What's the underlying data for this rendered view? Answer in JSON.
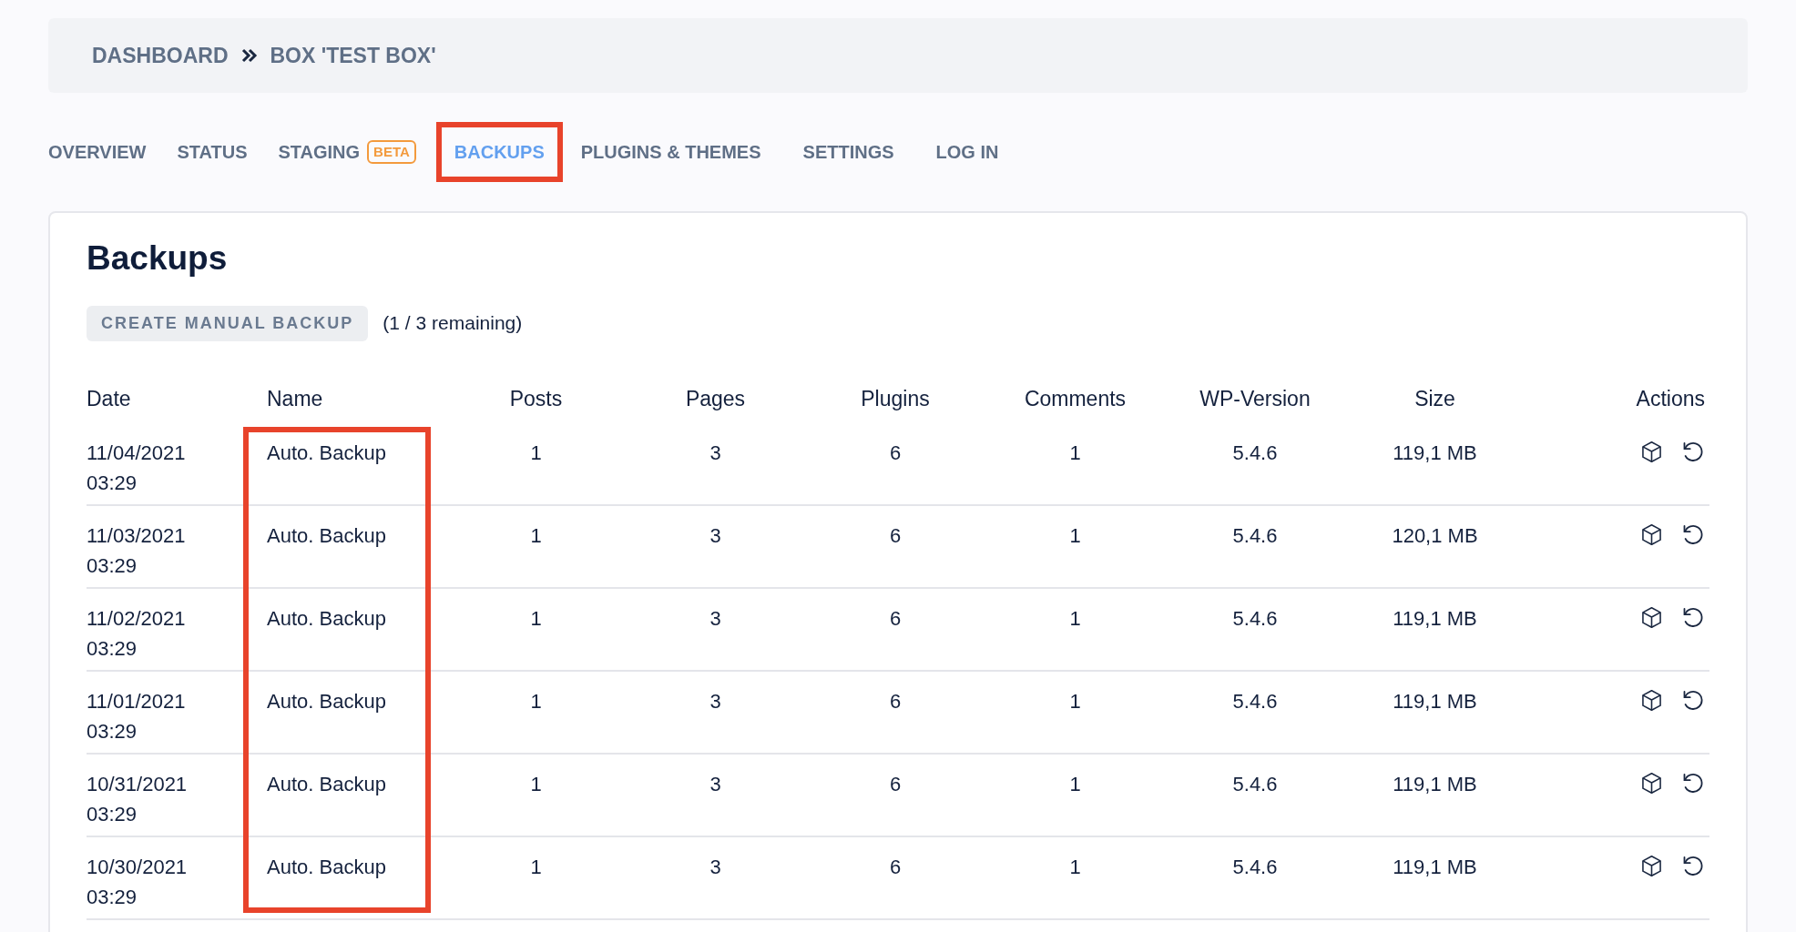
{
  "breadcrumb": [
    "DASHBOARD",
    "BOX 'TEST BOX'"
  ],
  "tabs": [
    {
      "label": "OVERVIEW",
      "selected": false,
      "highlighted": false
    },
    {
      "label": "STATUS",
      "selected": false,
      "highlighted": false
    },
    {
      "label": "STAGING",
      "badge": "BETA",
      "selected": false,
      "highlighted": false
    },
    {
      "label": "BACKUPS",
      "selected": true,
      "highlighted": true
    },
    {
      "label": "PLUGINS & THEMES",
      "selected": false,
      "highlighted": false
    },
    {
      "label": "SETTINGS",
      "selected": false,
      "highlighted": false
    },
    {
      "label": "LOG IN",
      "selected": false,
      "highlighted": false
    }
  ],
  "card": {
    "title": "Backups",
    "button": "CREATE MANUAL BACKUP",
    "remaining": "(1 / 3 remaining)"
  },
  "table": {
    "columns": [
      {
        "label": "Date",
        "highlighted": false
      },
      {
        "label": "Name",
        "highlighted": true
      },
      {
        "label": "Posts",
        "highlighted": false
      },
      {
        "label": "Pages",
        "highlighted": false
      },
      {
        "label": "Plugins",
        "highlighted": false
      },
      {
        "label": "Comments",
        "highlighted": false
      },
      {
        "label": "WP-Version",
        "highlighted": false
      },
      {
        "label": "Size",
        "highlighted": false
      },
      {
        "label": "Actions",
        "highlighted": false
      }
    ],
    "rows": [
      {
        "cells": [
          "11/04/2021 03:29",
          "Auto. Backup",
          "1",
          "3",
          "6",
          "1",
          "5.4.6",
          "119,1 MB"
        ]
      },
      {
        "cells": [
          "11/03/2021 03:29",
          "Auto. Backup",
          "1",
          "3",
          "6",
          "1",
          "5.4.6",
          "120,1 MB"
        ]
      },
      {
        "cells": [
          "11/02/2021 03:29",
          "Auto. Backup",
          "1",
          "3",
          "6",
          "1",
          "5.4.6",
          "119,1 MB"
        ]
      },
      {
        "cells": [
          "11/01/2021 03:29",
          "Auto. Backup",
          "1",
          "3",
          "6",
          "1",
          "5.4.6",
          "119,1 MB"
        ]
      },
      {
        "cells": [
          "10/31/2021 03:29",
          "Auto. Backup",
          "1",
          "3",
          "6",
          "1",
          "5.4.6",
          "119,1 MB"
        ]
      },
      {
        "cells": [
          "10/30/2021 03:29",
          "Auto. Backup",
          "1",
          "3",
          "6",
          "1",
          "5.4.6",
          "119,1 MB"
        ]
      }
    ]
  }
}
